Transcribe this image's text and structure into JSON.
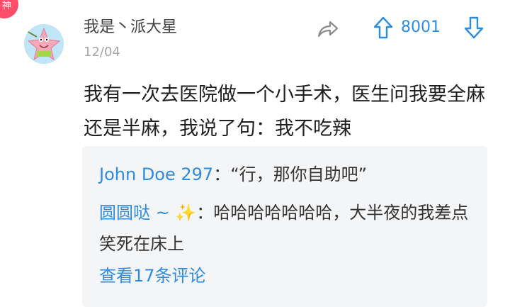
{
  "badge": {
    "text": "神"
  },
  "post": {
    "username": "我是丶派大星",
    "date": "12/04",
    "votes": "8001",
    "content": "我有一次去医院做一个小手术，医生问我要全麻还是半麻，我说了句：我不吃辣"
  },
  "replies": [
    {
      "author": "John Doe 297",
      "separator": "：",
      "text": "“行，那你自助吧”"
    },
    {
      "author": "圆圆哒 ~ ",
      "emoji": "✨",
      "separator": "：",
      "text": "哈哈哈哈哈哈哈，大半夜的我差点笑死在床上"
    }
  ],
  "view_all": "查看17条评论",
  "colors": {
    "accent_blue": "#2d8ce0",
    "badge_red": "#ff4e6a",
    "panel_bg": "#f4f5f7"
  },
  "icons": [
    "share-icon",
    "arrow-up-icon",
    "arrow-down-icon",
    "sparkles-emoji"
  ]
}
